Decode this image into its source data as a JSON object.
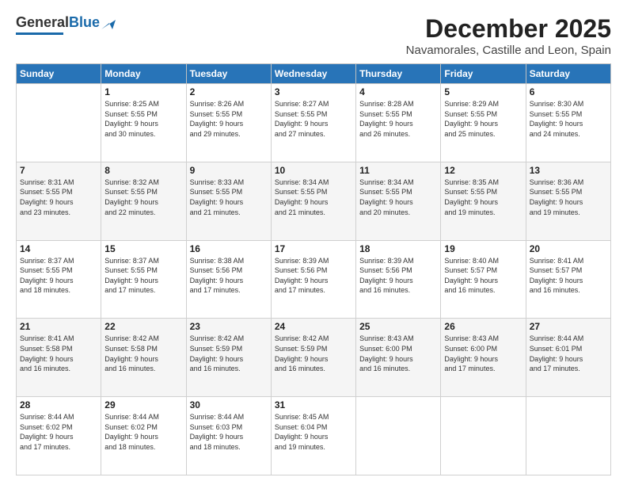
{
  "logo": {
    "general": "General",
    "blue": "Blue"
  },
  "title": {
    "month": "December 2025",
    "location": "Navamorales, Castille and Leon, Spain"
  },
  "headers": [
    "Sunday",
    "Monday",
    "Tuesday",
    "Wednesday",
    "Thursday",
    "Friday",
    "Saturday"
  ],
  "weeks": [
    [
      {
        "day": "",
        "info": ""
      },
      {
        "day": "1",
        "info": "Sunrise: 8:25 AM\nSunset: 5:55 PM\nDaylight: 9 hours\nand 30 minutes."
      },
      {
        "day": "2",
        "info": "Sunrise: 8:26 AM\nSunset: 5:55 PM\nDaylight: 9 hours\nand 29 minutes."
      },
      {
        "day": "3",
        "info": "Sunrise: 8:27 AM\nSunset: 5:55 PM\nDaylight: 9 hours\nand 27 minutes."
      },
      {
        "day": "4",
        "info": "Sunrise: 8:28 AM\nSunset: 5:55 PM\nDaylight: 9 hours\nand 26 minutes."
      },
      {
        "day": "5",
        "info": "Sunrise: 8:29 AM\nSunset: 5:55 PM\nDaylight: 9 hours\nand 25 minutes."
      },
      {
        "day": "6",
        "info": "Sunrise: 8:30 AM\nSunset: 5:55 PM\nDaylight: 9 hours\nand 24 minutes."
      }
    ],
    [
      {
        "day": "7",
        "info": "Sunrise: 8:31 AM\nSunset: 5:55 PM\nDaylight: 9 hours\nand 23 minutes."
      },
      {
        "day": "8",
        "info": "Sunrise: 8:32 AM\nSunset: 5:55 PM\nDaylight: 9 hours\nand 22 minutes."
      },
      {
        "day": "9",
        "info": "Sunrise: 8:33 AM\nSunset: 5:55 PM\nDaylight: 9 hours\nand 21 minutes."
      },
      {
        "day": "10",
        "info": "Sunrise: 8:34 AM\nSunset: 5:55 PM\nDaylight: 9 hours\nand 21 minutes."
      },
      {
        "day": "11",
        "info": "Sunrise: 8:34 AM\nSunset: 5:55 PM\nDaylight: 9 hours\nand 20 minutes."
      },
      {
        "day": "12",
        "info": "Sunrise: 8:35 AM\nSunset: 5:55 PM\nDaylight: 9 hours\nand 19 minutes."
      },
      {
        "day": "13",
        "info": "Sunrise: 8:36 AM\nSunset: 5:55 PM\nDaylight: 9 hours\nand 19 minutes."
      }
    ],
    [
      {
        "day": "14",
        "info": "Sunrise: 8:37 AM\nSunset: 5:55 PM\nDaylight: 9 hours\nand 18 minutes."
      },
      {
        "day": "15",
        "info": "Sunrise: 8:37 AM\nSunset: 5:55 PM\nDaylight: 9 hours\nand 17 minutes."
      },
      {
        "day": "16",
        "info": "Sunrise: 8:38 AM\nSunset: 5:56 PM\nDaylight: 9 hours\nand 17 minutes."
      },
      {
        "day": "17",
        "info": "Sunrise: 8:39 AM\nSunset: 5:56 PM\nDaylight: 9 hours\nand 17 minutes."
      },
      {
        "day": "18",
        "info": "Sunrise: 8:39 AM\nSunset: 5:56 PM\nDaylight: 9 hours\nand 16 minutes."
      },
      {
        "day": "19",
        "info": "Sunrise: 8:40 AM\nSunset: 5:57 PM\nDaylight: 9 hours\nand 16 minutes."
      },
      {
        "day": "20",
        "info": "Sunrise: 8:41 AM\nSunset: 5:57 PM\nDaylight: 9 hours\nand 16 minutes."
      }
    ],
    [
      {
        "day": "21",
        "info": "Sunrise: 8:41 AM\nSunset: 5:58 PM\nDaylight: 9 hours\nand 16 minutes."
      },
      {
        "day": "22",
        "info": "Sunrise: 8:42 AM\nSunset: 5:58 PM\nDaylight: 9 hours\nand 16 minutes."
      },
      {
        "day": "23",
        "info": "Sunrise: 8:42 AM\nSunset: 5:59 PM\nDaylight: 9 hours\nand 16 minutes."
      },
      {
        "day": "24",
        "info": "Sunrise: 8:42 AM\nSunset: 5:59 PM\nDaylight: 9 hours\nand 16 minutes."
      },
      {
        "day": "25",
        "info": "Sunrise: 8:43 AM\nSunset: 6:00 PM\nDaylight: 9 hours\nand 16 minutes."
      },
      {
        "day": "26",
        "info": "Sunrise: 8:43 AM\nSunset: 6:00 PM\nDaylight: 9 hours\nand 17 minutes."
      },
      {
        "day": "27",
        "info": "Sunrise: 8:44 AM\nSunset: 6:01 PM\nDaylight: 9 hours\nand 17 minutes."
      }
    ],
    [
      {
        "day": "28",
        "info": "Sunrise: 8:44 AM\nSunset: 6:02 PM\nDaylight: 9 hours\nand 17 minutes."
      },
      {
        "day": "29",
        "info": "Sunrise: 8:44 AM\nSunset: 6:02 PM\nDaylight: 9 hours\nand 18 minutes."
      },
      {
        "day": "30",
        "info": "Sunrise: 8:44 AM\nSunset: 6:03 PM\nDaylight: 9 hours\nand 18 minutes."
      },
      {
        "day": "31",
        "info": "Sunrise: 8:45 AM\nSunset: 6:04 PM\nDaylight: 9 hours\nand 19 minutes."
      },
      {
        "day": "",
        "info": ""
      },
      {
        "day": "",
        "info": ""
      },
      {
        "day": "",
        "info": ""
      }
    ]
  ]
}
